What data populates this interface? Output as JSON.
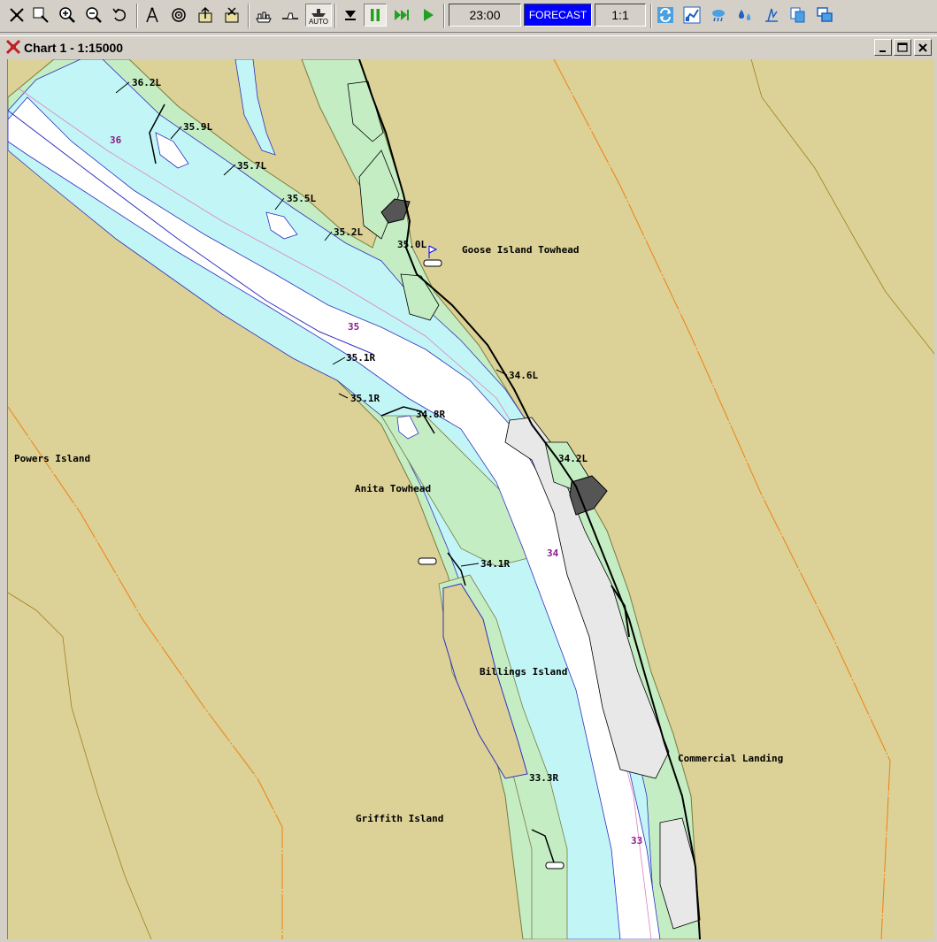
{
  "toolbar": {
    "buttons": [
      {
        "name": "select-tool-icon"
      },
      {
        "name": "zoom-box-icon"
      },
      {
        "name": "zoom-in-icon"
      },
      {
        "name": "zoom-out-icon"
      },
      {
        "name": "undo-zoom-icon"
      },
      {
        "name": "compass-icon"
      },
      {
        "name": "target-icon"
      },
      {
        "name": "export-icon"
      },
      {
        "name": "import-icon"
      },
      {
        "name": "vessel-icon"
      },
      {
        "name": "boat-icon"
      },
      {
        "name": "auto-vessel-icon"
      },
      {
        "name": "skip-down-icon"
      },
      {
        "name": "pause-icon"
      },
      {
        "name": "fast-forward-icon"
      },
      {
        "name": "play-icon"
      },
      {
        "name": "refresh-icon"
      },
      {
        "name": "graph-icon"
      },
      {
        "name": "weather-icon"
      },
      {
        "name": "water-icon"
      },
      {
        "name": "tide-icon"
      },
      {
        "name": "copy-icon"
      },
      {
        "name": "windows-icon"
      }
    ],
    "auto_label": "AUTO",
    "time": "23:00",
    "forecast_label": "FORECAST",
    "scale_ratio": "1:1"
  },
  "window": {
    "title": "Chart 1 - 1:15000"
  },
  "chart": {
    "place_labels": [
      "Goose Island Towhead",
      "Powers Island",
      "Anita Towhead",
      "Billings Island",
      "Commercial Landing",
      "Griffith Island"
    ],
    "markers": [
      "36.2L",
      "35.9L",
      "35.7L",
      "35.5L",
      "35.2L",
      "35.0L",
      "35.1R",
      "35.1R",
      "34.8R",
      "34.6L",
      "34.2L",
      "34.1R",
      "33.3R"
    ],
    "mile_labels": [
      "36",
      "35",
      "34",
      "33"
    ],
    "colors": {
      "land": "#dcd196",
      "shore": "#c4edc4",
      "shallow": "#c2f6f6",
      "channel": "#ffffff",
      "mile": "#8b1c8b",
      "highlight": "#0000ff"
    }
  }
}
